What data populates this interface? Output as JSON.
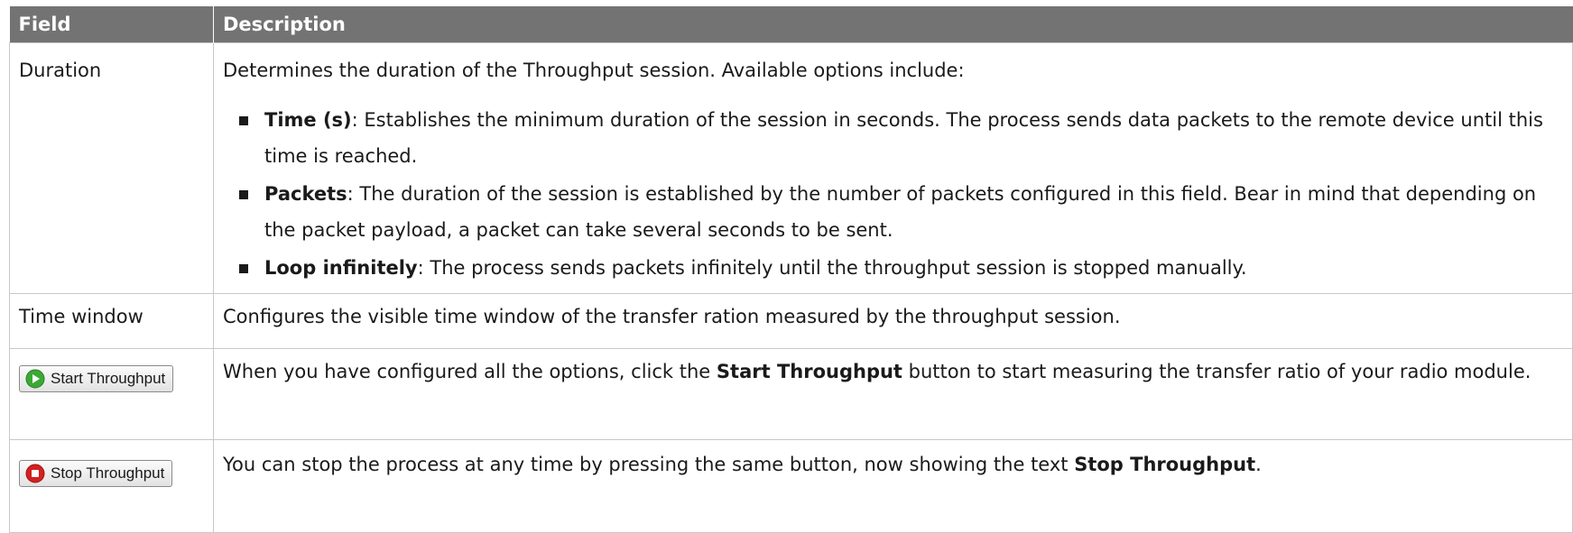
{
  "table": {
    "headers": {
      "field": "Field",
      "description": "Description"
    },
    "duration": {
      "field": "Duration",
      "intro": "Determines the duration of the Throughput session. Available options include:",
      "options": [
        {
          "name": "Time (s)",
          "text": ": Establishes the minimum duration of the session in seconds. The process sends data packets to the remote device until this time is reached."
        },
        {
          "name": "Packets",
          "text": ": The duration of the session is established by the number of packets configured in this field. Bear in mind that depending on the packet payload, a packet can take several seconds to be sent."
        },
        {
          "name": "Loop infinitely",
          "text": ": The process sends packets infinitely until the throughput session is stopped manually."
        }
      ]
    },
    "time_window": {
      "field": "Time window",
      "description": "Configures the visible time window of the transfer ration measured by the throughput session."
    },
    "start": {
      "button_label": "Start Throughput",
      "icon": "green-play-icon",
      "desc_before": "When you have configured all the options, click the ",
      "desc_bold": "Start Throughput",
      "desc_after": " button to start measuring the transfer ratio of your radio module."
    },
    "stop": {
      "button_label": "Stop Throughput",
      "icon": "red-stop-icon",
      "desc_before": "You can stop the process at any time by pressing the same button, now showing the text ",
      "desc_bold": "Stop Throughput",
      "desc_after": "."
    }
  },
  "colors": {
    "header_bg": "#737373",
    "start_icon": "#3aa935",
    "stop_icon": "#d42020"
  }
}
